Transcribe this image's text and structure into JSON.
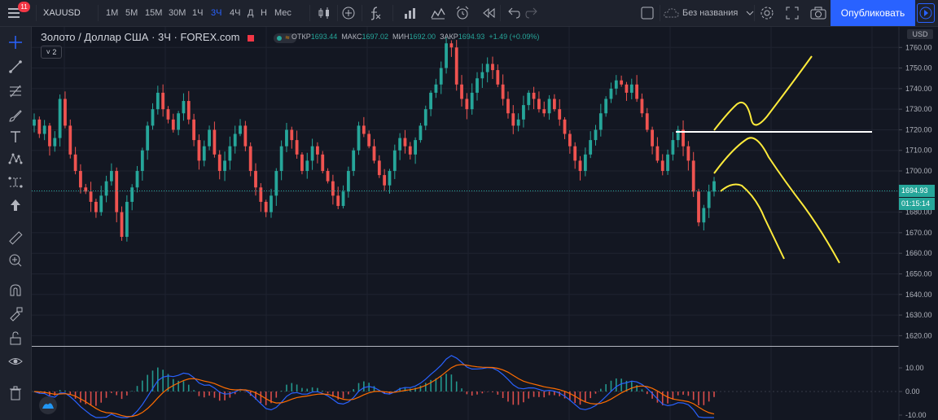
{
  "toolbar": {
    "notifications": "11",
    "symbol": "XAUUSD",
    "intervals": [
      "1М",
      "5М",
      "15М",
      "30М",
      "1Ч",
      "3Ч",
      "4Ч",
      "Д",
      "Н",
      "Мес"
    ],
    "active_interval": "3Ч",
    "layout_name": "Без названия",
    "publish_label": "Опубликовать"
  },
  "legend": {
    "title": "Золото / Доллар США · 3Ч · FOREX.com",
    "open_label": "ОТКР",
    "open": "1693.44",
    "high_label": "МАКС",
    "high": "1697.02",
    "low_label": "МИН",
    "low": "1692.00",
    "close_label": "ЗАКР",
    "close": "1694.93",
    "change": "+1.49 (+0.09%)",
    "collapse": "2"
  },
  "price_axis": {
    "currency": "USD",
    "ticks": [
      "1760.00",
      "1750.00",
      "1740.00",
      "1730.00",
      "1720.00",
      "1710.00",
      "1700.00",
      "1690.00",
      "1680.00",
      "1670.00",
      "1660.00",
      "1650.00",
      "1640.00",
      "1630.00",
      "1620.00"
    ],
    "current_price": "1694.93",
    "countdown": "01:15:14"
  },
  "indicator_axis": {
    "ticks": [
      "10.00",
      "0.00",
      "-10.00"
    ]
  },
  "colors": {
    "up": "#26a69a",
    "down": "#ef5350",
    "background": "#131722",
    "annotation": "#ffeb3b"
  },
  "chart_data": {
    "type": "candlestick",
    "ylim": [
      1615,
      1770
    ],
    "current": 1694.93,
    "closes": [
      1725,
      1718,
      1722,
      1712,
      1716,
      1735,
      1722,
      1708,
      1700,
      1692,
      1690,
      1685,
      1680,
      1688,
      1695,
      1700,
      1680,
      1668,
      1685,
      1692,
      1700,
      1710,
      1722,
      1730,
      1738,
      1730,
      1725,
      1720,
      1728,
      1734,
      1725,
      1715,
      1705,
      1712,
      1720,
      1708,
      1700,
      1705,
      1712,
      1718,
      1722,
      1712,
      1700,
      1692,
      1685,
      1680,
      1688,
      1700,
      1712,
      1720,
      1715,
      1708,
      1700,
      1705,
      1712,
      1708,
      1700,
      1695,
      1688,
      1683,
      1690,
      1700,
      1710,
      1722,
      1718,
      1712,
      1705,
      1698,
      1693,
      1700,
      1710,
      1716,
      1712,
      1708,
      1715,
      1722,
      1730,
      1738,
      1742,
      1750,
      1762,
      1760,
      1742,
      1735,
      1730,
      1738,
      1745,
      1748,
      1752,
      1749,
      1742,
      1735,
      1728,
      1722,
      1725,
      1732,
      1738,
      1735,
      1730,
      1728,
      1735,
      1730,
      1725,
      1718,
      1712,
      1705,
      1700,
      1708,
      1715,
      1720,
      1728,
      1735,
      1740,
      1744,
      1742,
      1738,
      1742,
      1735,
      1728,
      1720,
      1712,
      1705,
      1700,
      1708,
      1715,
      1720,
      1712,
      1705,
      1690,
      1675,
      1682,
      1690,
      1695
    ]
  }
}
